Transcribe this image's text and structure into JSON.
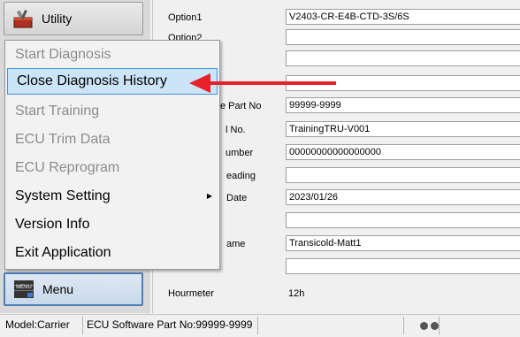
{
  "nav": {
    "utility_label": "Utility",
    "menu_label": "Menu",
    "menu_icon_text": "MENU"
  },
  "form": {
    "rows": [
      {
        "label": "Option1",
        "value": "V2403-CR-E4B-CTD-3S/6S"
      },
      {
        "label": "Option2",
        "value": ""
      },
      {
        "label": "",
        "value": ""
      },
      {
        "label": "",
        "value": ""
      },
      {
        "label": "e Part No",
        "value": "99999-9999"
      },
      {
        "label": "l No.",
        "value": "TrainingTRU-V001"
      },
      {
        "label": "umber",
        "value": "00000000000000000"
      },
      {
        "label": "eading",
        "value": ""
      },
      {
        "label": "Date",
        "value": "2023/01/26"
      },
      {
        "label": "",
        "value": ""
      },
      {
        "label": "ame",
        "value": "Transicold-Matt1"
      },
      {
        "label": "",
        "value": ""
      }
    ],
    "hourmeter_label": "Hourmeter",
    "hourmeter_value": "12h"
  },
  "menu_items": [
    {
      "label": "Start Diagnosis",
      "enabled": false
    },
    {
      "label": "Close Diagnosis History",
      "enabled": true,
      "highlighted": true
    },
    {
      "label": "Start Training",
      "enabled": false
    },
    {
      "label": "ECU Trim Data",
      "enabled": false
    },
    {
      "label": "ECU Reprogram",
      "enabled": false
    },
    {
      "label": "System Setting",
      "enabled": true,
      "submenu": true
    },
    {
      "label": "Version Info",
      "enabled": true
    },
    {
      "label": "Exit Application",
      "enabled": true
    }
  ],
  "status": {
    "model": "Model:Carrier",
    "ecu_part": "ECU Software Part No:99999-9999"
  },
  "annotation": {
    "arrow_color": "#e8202a"
  }
}
